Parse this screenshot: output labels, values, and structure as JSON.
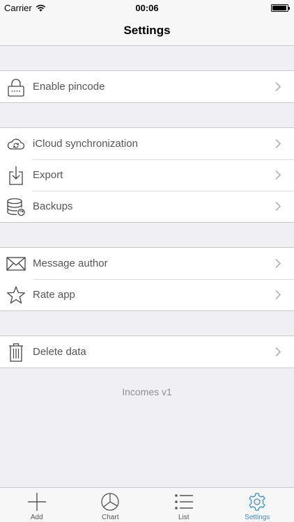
{
  "status_bar": {
    "carrier": "Carrier",
    "time": "00:06",
    "battery_level": 0.95
  },
  "nav": {
    "title": "Settings"
  },
  "groups": [
    {
      "items": [
        {
          "label": "Enable pincode",
          "icon": "lock-icon"
        }
      ]
    },
    {
      "items": [
        {
          "label": "iCloud synchronization",
          "icon": "cloud-sync-icon"
        },
        {
          "label": "Export",
          "icon": "export-icon"
        },
        {
          "label": "Backups",
          "icon": "database-icon"
        }
      ]
    },
    {
      "items": [
        {
          "label": "Message author",
          "icon": "envelope-icon"
        },
        {
          "label": "Rate app",
          "icon": "star-icon"
        }
      ]
    },
    {
      "items": [
        {
          "label": "Delete data",
          "icon": "trash-icon"
        }
      ]
    }
  ],
  "footer": {
    "version": "Incomes v1"
  },
  "tab_bar": {
    "active": "Settings",
    "tabs": [
      {
        "label": "Add",
        "icon": "plus-icon"
      },
      {
        "label": "Chart",
        "icon": "pie-chart-icon"
      },
      {
        "label": "List",
        "icon": "list-icon"
      },
      {
        "label": "Settings",
        "icon": "gear-icon"
      }
    ]
  },
  "colors": {
    "background": "#efeff4",
    "accent": "#3a8dc9",
    "text": "#555555",
    "separator": "#c8c7cc"
  }
}
